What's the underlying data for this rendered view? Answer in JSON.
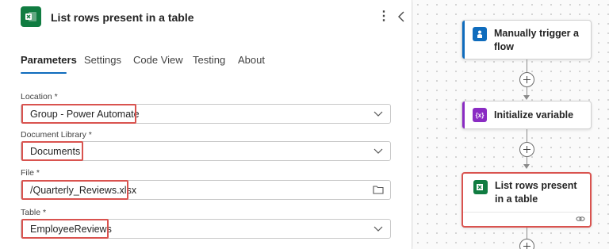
{
  "panel": {
    "title": "List rows present in a table",
    "icon": "excel-icon"
  },
  "tabs": [
    {
      "label": "Parameters",
      "active": true
    },
    {
      "label": "Settings",
      "active": false
    },
    {
      "label": "Code View",
      "active": false
    },
    {
      "label": "Testing",
      "active": false
    },
    {
      "label": "About",
      "active": false
    }
  ],
  "fields": {
    "location": {
      "label": "Location *",
      "value": "Group - Power Automate"
    },
    "document_library": {
      "label": "Document Library *",
      "value": "Documents"
    },
    "file": {
      "label": "File *",
      "value": "/Quarterly_Reviews.xlsx"
    },
    "table": {
      "label": "Table *",
      "value": "EmployeeReviews"
    }
  },
  "flow": {
    "nodes": [
      {
        "label": "Manually trigger a flow",
        "icon": "hand-trigger-icon",
        "color": "#0f6cbd"
      },
      {
        "label": "Initialize variable",
        "icon": "variable-icon",
        "color": "#8a2cc3"
      },
      {
        "label": "List rows present in a table",
        "icon": "excel-icon",
        "color": "#107c41"
      }
    ]
  },
  "colors": {
    "accent": "#0f6cbd",
    "highlight": "#d9534f",
    "excel": "#107c41"
  }
}
